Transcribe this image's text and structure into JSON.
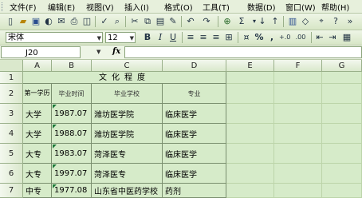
{
  "menu": [
    "文件(F)",
    "编辑(E)",
    "视图(V)",
    "插入(I)",
    "格式(O)",
    "工具(T)",
    "数据(D)",
    "窗口(W)",
    "帮助(H)"
  ],
  "toolbar": {
    "font_name": "宋体",
    "font_size": "12",
    "bold": "B",
    "italic": "I",
    "underline": "U",
    "percent": "%",
    "comma": ","
  },
  "formula_bar": {
    "name_box": "J20",
    "fx": "fx",
    "content": ""
  },
  "columns": [
    "A",
    "B",
    "C",
    "D",
    "E",
    "F",
    "G"
  ],
  "rows": [
    "1",
    "2",
    "3",
    "4",
    "5",
    "6",
    "7"
  ],
  "sheet": {
    "title": "文化程度",
    "headers": [
      "第一学历",
      "毕业时间",
      "毕业学校",
      "专业"
    ],
    "data": [
      [
        "大学",
        "1987.07",
        "潍坊医学院",
        "临床医学"
      ],
      [
        "大学",
        "1988.07",
        "潍坊医学院",
        "临床医学"
      ],
      [
        "大专",
        "1983.07",
        "菏泽医专",
        "临床医学"
      ],
      [
        "大专",
        "1997.07",
        "菏泽医专",
        "临床医学"
      ],
      [
        "中专",
        "1977.08",
        "山东省中医药学校",
        "药剂"
      ]
    ]
  }
}
